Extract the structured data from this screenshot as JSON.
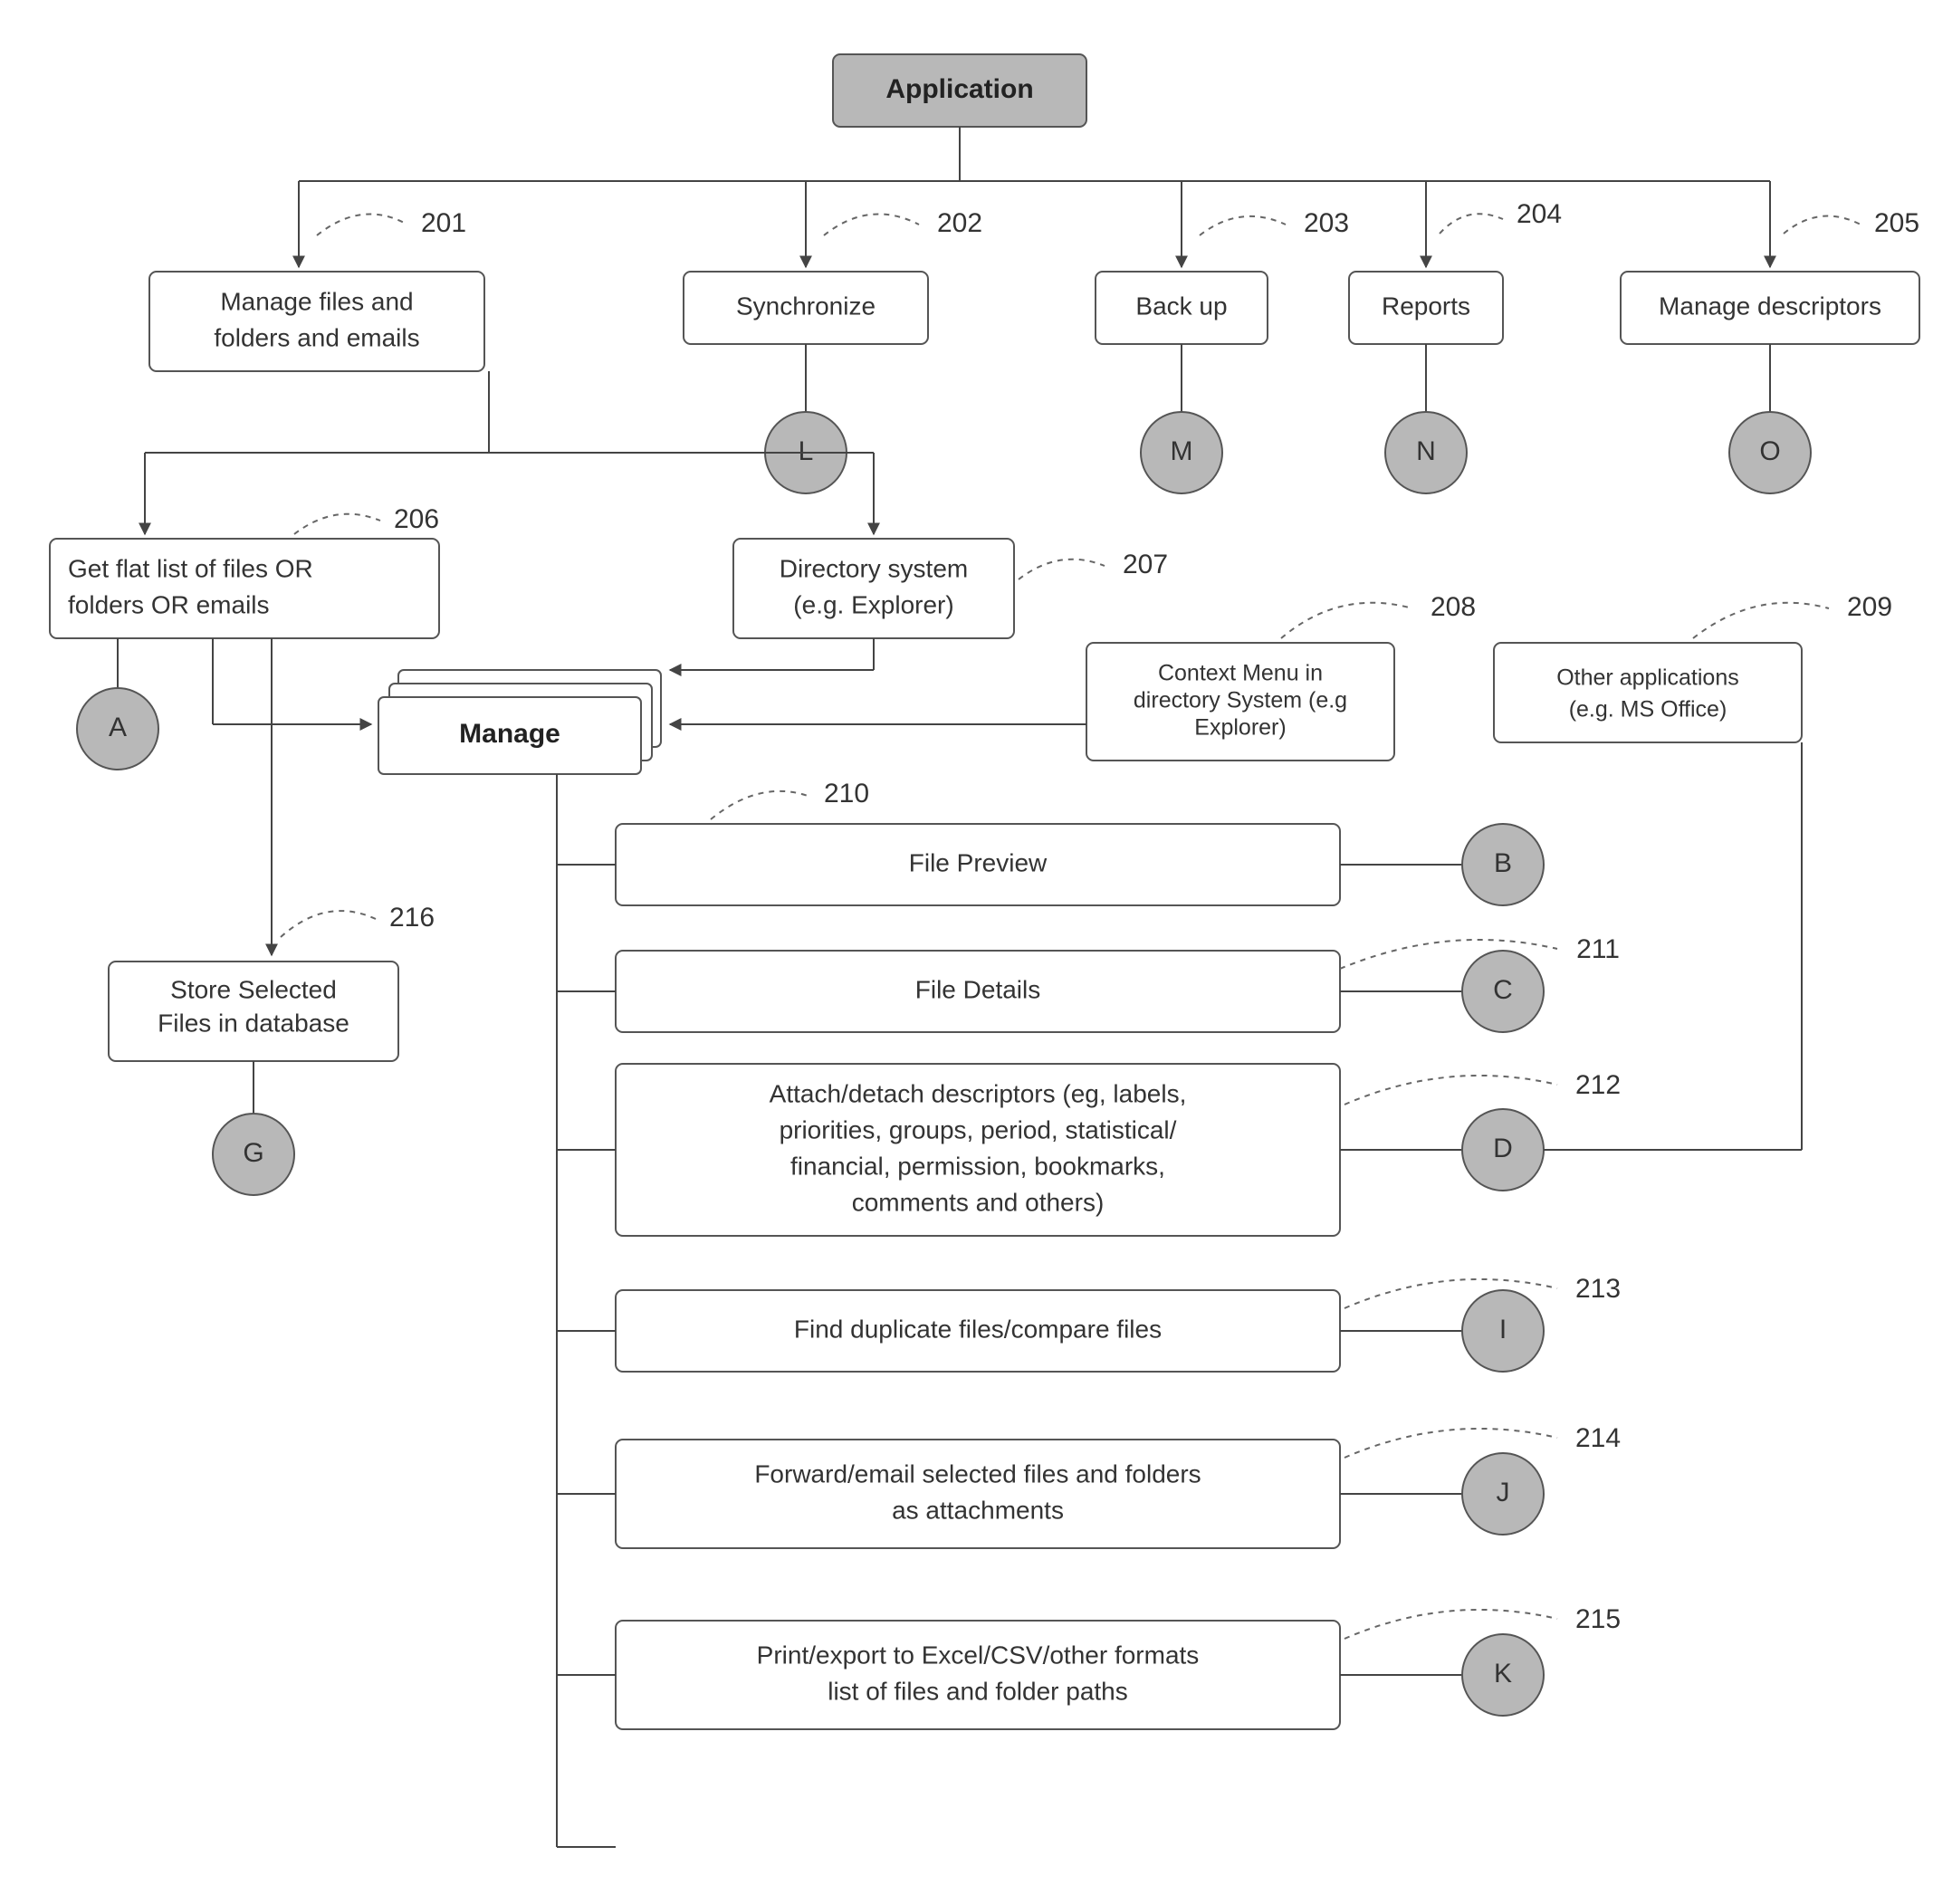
{
  "root": {
    "label": "Application"
  },
  "level1": {
    "n201": {
      "line1": "Manage files and",
      "line2": "folders and emails",
      "label": "201"
    },
    "n202": {
      "line1": "Synchronize",
      "label": "202"
    },
    "n203": {
      "line1": "Back up",
      "label": "203"
    },
    "n204": {
      "line1": "Reports",
      "label": "204"
    },
    "n205": {
      "line1": "Manage descriptors",
      "label": "205"
    }
  },
  "circlesTop": {
    "L": "L",
    "M": "M",
    "N": "N",
    "O": "O"
  },
  "n206": {
    "line1": "Get flat list of files OR",
    "line2": "folders OR emails",
    "label": "206"
  },
  "n207": {
    "line1": "Directory system",
    "line2": "(e.g. Explorer)",
    "label": "207"
  },
  "n208": {
    "line1": "Context Menu in",
    "line2": "directory System (e.g",
    "line3": "Explorer)",
    "label": "208"
  },
  "n209": {
    "line1": "Other applications",
    "line2": "(e.g. MS Office)",
    "label": "209"
  },
  "circleA": "A",
  "manage": {
    "label": "Manage"
  },
  "n216": {
    "line1": "Store Selected",
    "line2": "Files in database",
    "label": "216"
  },
  "circleG": "G",
  "detail": {
    "n210": {
      "text": "File Preview",
      "label": "210"
    },
    "n211": {
      "text": "File Details",
      "label": "211"
    },
    "n212": {
      "line1": "Attach/detach descriptors (eg, labels,",
      "line2": "priorities, groups, period, statistical/",
      "line3": "financial, permission, bookmarks,",
      "line4": "comments and others)",
      "label": "212"
    },
    "n213": {
      "text": "Find duplicate files/compare files",
      "label": "213"
    },
    "n214": {
      "line1": "Forward/email selected files and folders",
      "line2": "as attachments",
      "label": "214"
    },
    "n215": {
      "line1": "Print/export to Excel/CSV/other formats",
      "line2": "list of files and folder paths",
      "label": "215"
    }
  },
  "circlesRight": {
    "B": "B",
    "C": "C",
    "D": "D",
    "I": "I",
    "J": "J",
    "K": "K"
  }
}
